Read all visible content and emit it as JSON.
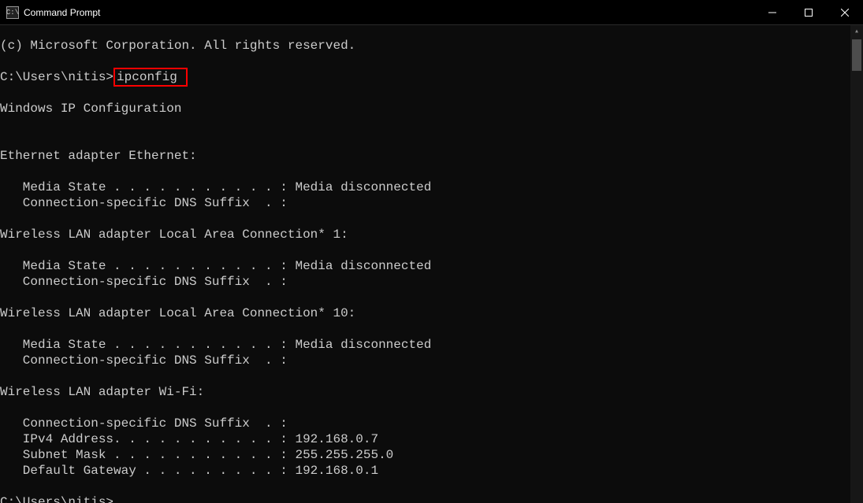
{
  "window": {
    "icon_label": "C:\\",
    "title": "Command Prompt"
  },
  "terminal": {
    "copyright": "(c) Microsoft Corporation. All rights reserved.",
    "prompt1_path": "C:\\Users\\nitis>",
    "prompt1_cmd": "ipconfig",
    "header": "Windows IP Configuration",
    "adapters": [
      {
        "title": "Ethernet adapter Ethernet:",
        "lines": [
          "   Media State . . . . . . . . . . . : Media disconnected",
          "   Connection-specific DNS Suffix  . :"
        ]
      },
      {
        "title": "Wireless LAN adapter Local Area Connection* 1:",
        "lines": [
          "   Media State . . . . . . . . . . . : Media disconnected",
          "   Connection-specific DNS Suffix  . :"
        ]
      },
      {
        "title": "Wireless LAN adapter Local Area Connection* 10:",
        "lines": [
          "   Media State . . . . . . . . . . . : Media disconnected",
          "   Connection-specific DNS Suffix  . :"
        ]
      },
      {
        "title": "Wireless LAN adapter Wi-Fi:",
        "lines": [
          "   Connection-specific DNS Suffix  . :",
          "   IPv4 Address. . . . . . . . . . . : 192.168.0.7",
          "   Subnet Mask . . . . . . . . . . . : 255.255.255.0",
          "   Default Gateway . . . . . . . . . : 192.168.0.1"
        ]
      }
    ],
    "prompt2_path": "C:\\Users\\nitis>"
  }
}
